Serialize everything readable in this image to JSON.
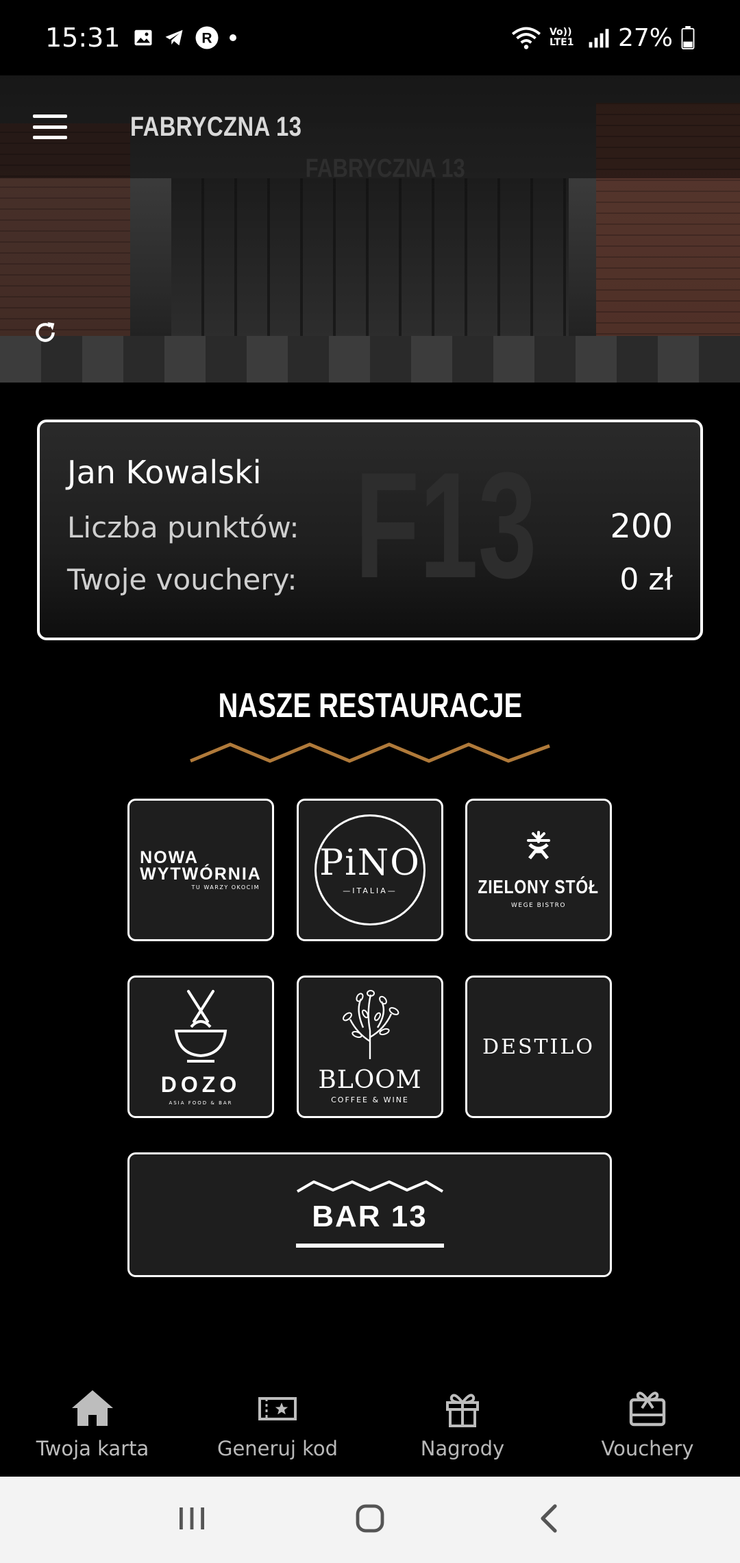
{
  "status_bar": {
    "time": "15:31",
    "network_label": "Vo)) LTE1",
    "battery": "27%"
  },
  "header": {
    "title": "FABRYCZNA 13",
    "hero_sign": "FABRYCZNA 13"
  },
  "card": {
    "name": "Jan Kowalski",
    "points_label": "Liczba punktów:",
    "points_value": "200",
    "vouchers_label": "Twoje vouchery:",
    "vouchers_value": "0 zł",
    "watermark": "F13"
  },
  "section": {
    "title": "NASZE RESTAURACJE"
  },
  "restaurants": [
    {
      "name": "NOWA WYTWÓRNIA",
      "line1": "NOWA",
      "line2": "WYTWÓRNIA",
      "tagline": "TU WARZY OKOCIM"
    },
    {
      "name": "PINO",
      "logo_text": "PiNO",
      "tagline": "ITALIA"
    },
    {
      "name": "ZIELONY STÓŁ",
      "tagline": "WEGE BISTRO"
    },
    {
      "name": "DOZO",
      "tagline": "ASIA FOOD & BAR"
    },
    {
      "name": "BLOOM",
      "tagline": "COFFEE & WINE"
    },
    {
      "name": "DESTILO"
    },
    {
      "name": "BAR 13"
    }
  ],
  "bottom_nav": [
    {
      "label": "Twoja karta",
      "icon": "home-icon",
      "active": true
    },
    {
      "label": "Generuj kod",
      "icon": "ticket-star-icon"
    },
    {
      "label": "Nagrody",
      "icon": "gift-icon"
    },
    {
      "label": "Vouchery",
      "icon": "gift-card-icon"
    }
  ],
  "system_nav": [
    "recents",
    "home",
    "back"
  ],
  "colors": {
    "accent_zigzag": "#b07a3a",
    "background": "#000000",
    "card_border": "#ffffff",
    "tile_bg": "#1e1e1e"
  }
}
